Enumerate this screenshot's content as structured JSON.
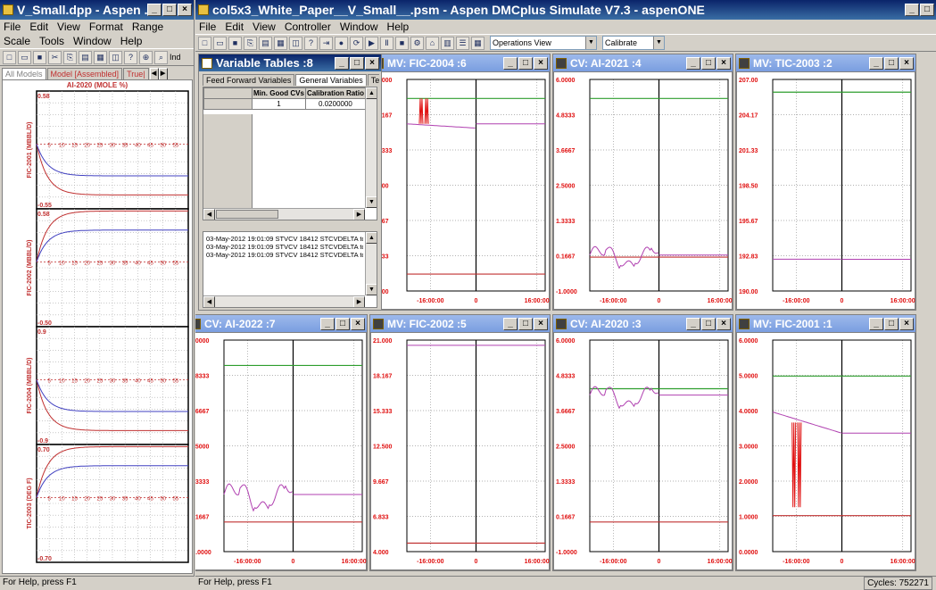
{
  "left_window": {
    "title": "V_Small.dpp - Aspen ...",
    "menu": [
      "File",
      "Edit",
      "View",
      "Format",
      "Range"
    ],
    "menu2": [
      "Scale",
      "Tools",
      "Window",
      "Help"
    ],
    "toolbar_tail": "Ind",
    "tabs": [
      "All Models",
      "Model [Assembled]",
      "True|"
    ],
    "chart_title": "AI-2020 (MOLE %)",
    "status": "For Help, press F1",
    "x_ticks": [
      "5",
      "10",
      "15",
      "20",
      "25",
      "30",
      "35",
      "40",
      "45",
      "50",
      "55"
    ],
    "subplots": [
      {
        "label": "FIC-2001 (MBBL/D)",
        "top": "0.58",
        "bottom": "-0.55"
      },
      {
        "label": "FIC-2002 (MBBL/D)",
        "top": "0.58",
        "bottom": "-0.50"
      },
      {
        "label": "FIC-2004 (MBBL/D)",
        "top": "0.9",
        "bottom": "-0.9"
      },
      {
        "label": "TIC-2003 (DEG F)",
        "top": "0.70",
        "bottom": "-0.70"
      }
    ]
  },
  "main_window": {
    "title": "col5x3_White_Paper__V_Small__.psm - Aspen DMCplus Simulate V7.3 - aspenONE",
    "menu": [
      "File",
      "Edit",
      "View",
      "Controller",
      "Window",
      "Help"
    ],
    "view_select": "Operations View",
    "mode_select": "Calibrate",
    "status": "For Help, press F1",
    "cycles": "Cycles: 752271"
  },
  "variable_tables": {
    "title": "Variable Tables :8",
    "tabs": [
      "Feed Forward Variables",
      "General Variables",
      "Test Group"
    ],
    "headers": [
      "Min. Good CVs",
      "Calibration Ratio"
    ],
    "row": [
      "1",
      "0.0200000"
    ],
    "log": [
      "03-May-2012 19:01:09 STVCV 18412 STCVDELTA too sm",
      "03-May-2012 19:01:09 STVCV 18412 STCVDELTA too sm",
      "03-May-2012 19:01:09 STVCV 18412 STCVDELTA too sm"
    ]
  },
  "x_axis_ticks": [
    "-16:00:00",
    "0",
    "16:00:00"
  ],
  "colors": {
    "limit_hi": "#2e9e2e",
    "limit_lo": "#c03030",
    "trace": "#b040b0",
    "spike": "#e01010",
    "axis_label": "#e01010"
  },
  "plots": [
    {
      "title": "MV: FIC-2004 :6",
      "y": [
        "14.000",
        "12.167",
        "10.333",
        "8.500",
        "6.667",
        "4.833",
        "3.000"
      ]
    },
    {
      "title": "CV: AI-2021 :4",
      "y": [
        "6.0000",
        "4.8333",
        "3.6667",
        "2.5000",
        "1.3333",
        "0.1667",
        "-1.0000"
      ]
    },
    {
      "title": "MV: TIC-2003 :2",
      "y": [
        "207.00",
        "204.17",
        "201.33",
        "198.50",
        "195.67",
        "192.83",
        "190.00"
      ]
    },
    {
      "title": "CV: AI-2022 :7",
      "y": [
        "6.0000",
        "4.8333",
        "3.6667",
        "2.5000",
        "1.3333",
        "0.1667",
        "-1.0000"
      ]
    },
    {
      "title": "MV: FIC-2002 :5",
      "y": [
        "21.000",
        "18.167",
        "15.333",
        "12.500",
        "9.667",
        "6.833",
        "4.000"
      ]
    },
    {
      "title": "CV: AI-2020 :3",
      "y": [
        "6.0000",
        "4.8333",
        "3.6667",
        "2.5000",
        "1.3333",
        "0.1667",
        "-1.0000"
      ]
    },
    {
      "title": "MV: FIC-2001 :1",
      "y": [
        "6.0000",
        "5.0000",
        "4.0000",
        "3.0000",
        "2.0000",
        "1.0000",
        "0.0000"
      ]
    }
  ]
}
